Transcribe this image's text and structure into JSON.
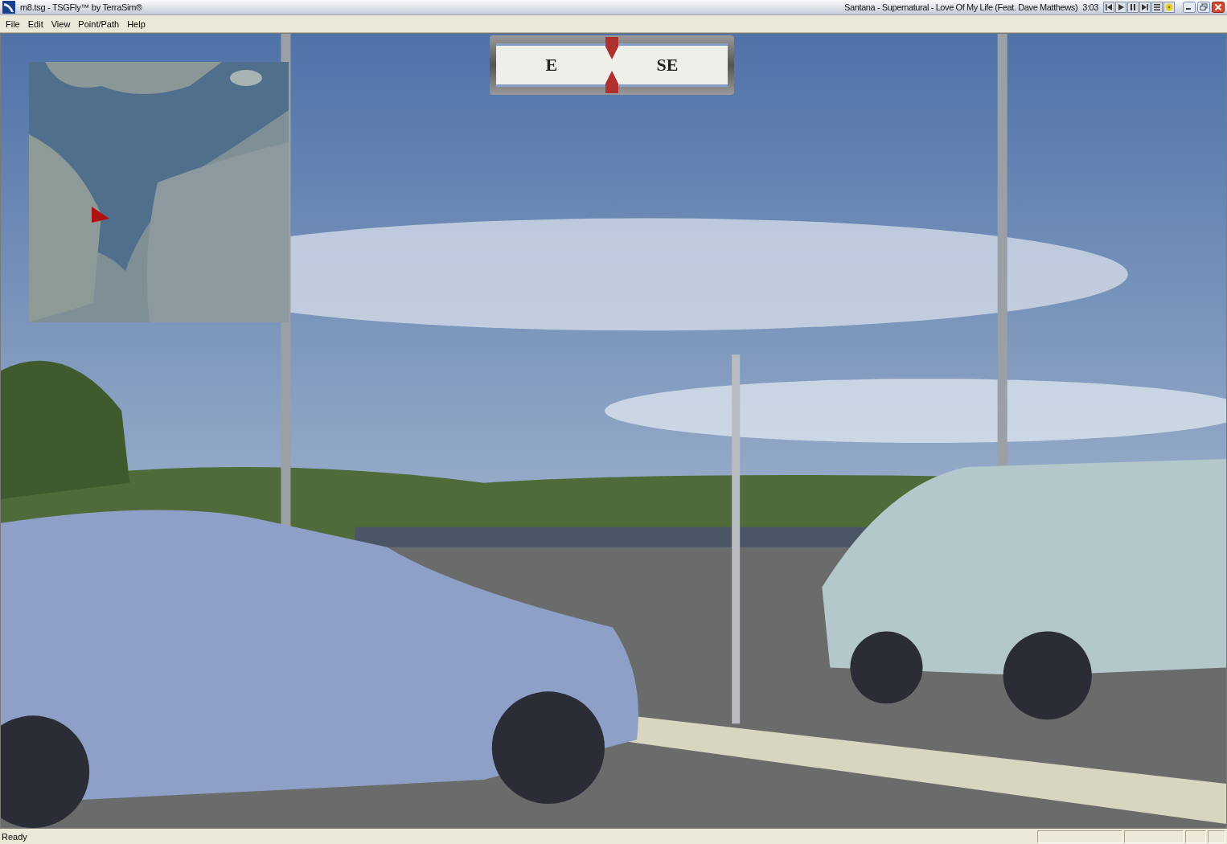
{
  "window": {
    "title": "m8.tsg - TSGFly™ by TerraSim®",
    "now_playing": "Santana - Supernatural - Love Of My Life (Feat. Dave Matthews)",
    "track_time": "3:03"
  },
  "media_controls": [
    {
      "kind": "previous"
    },
    {
      "kind": "play"
    },
    {
      "kind": "pause"
    },
    {
      "kind": "next"
    },
    {
      "kind": "playlist"
    },
    {
      "kind": "eject"
    }
  ],
  "menu": [
    {
      "label": "File"
    },
    {
      "label": "Edit"
    },
    {
      "label": "View"
    },
    {
      "label": "Point/Path"
    },
    {
      "label": "Help"
    }
  ],
  "compass": {
    "headings": [
      "E",
      "SE"
    ]
  },
  "status_bar": {
    "text": "Ready"
  }
}
